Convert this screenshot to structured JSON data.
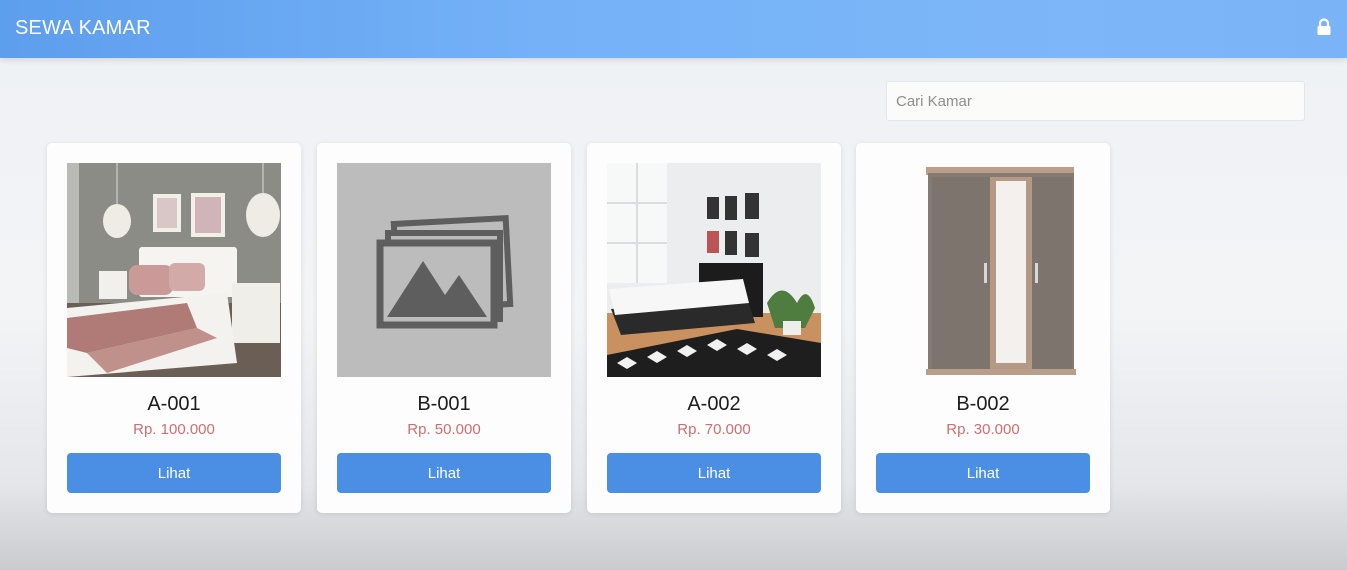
{
  "app": {
    "title": "SEWA KAMAR",
    "lock_icon": "lock-icon"
  },
  "search": {
    "placeholder": "Cari Kamar",
    "value": ""
  },
  "colors": {
    "navbar": "#6aaaf3",
    "button": "#4a8fe3",
    "price": "#cc6f6f"
  },
  "rooms": [
    {
      "code": "A-001",
      "price": "Rp. 100.000",
      "button": "Lihat",
      "image": "bedroom-photo"
    },
    {
      "code": "B-001",
      "price": "Rp. 50.000",
      "button": "Lihat",
      "image": "image-placeholder-icon"
    },
    {
      "code": "A-002",
      "price": "Rp. 70.000",
      "button": "Lihat",
      "image": "bedroom-photo"
    },
    {
      "code": "B-002",
      "price": "Rp. 30.000",
      "button": "Lihat",
      "image": "wardrobe-photo"
    }
  ]
}
